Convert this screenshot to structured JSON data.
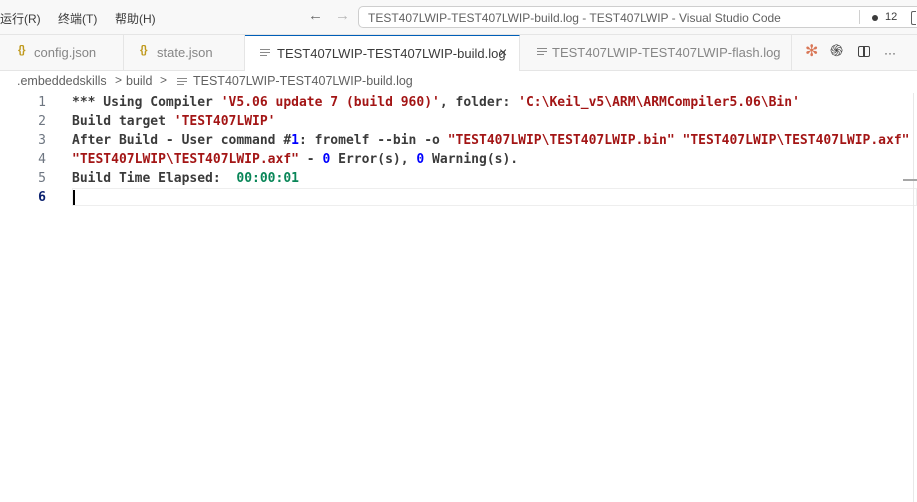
{
  "menu": {
    "run": "运行(R)",
    "terminal": "终端(T)",
    "help": "帮助(H)"
  },
  "navigation": {
    "back": "←",
    "forward": "→"
  },
  "command_center": {
    "title": "TEST407LWIP-TEST407LWIP-build.log - TEST407LWIP - Visual Studio Code",
    "problem_count": "12"
  },
  "tabs": [
    {
      "label": "config.json",
      "icon": "json-braces-icon",
      "active": false
    },
    {
      "label": "state.json",
      "icon": "json-braces-icon",
      "active": false
    },
    {
      "label": "TEST407LWIP-TEST407LWIP-build.log",
      "icon": "file-lines-icon",
      "active": true
    },
    {
      "label": "TEST407LWIP-TEST407LWIP-flash.log",
      "icon": "file-lines-icon",
      "active": false
    }
  ],
  "tab_close": "×",
  "tab_actions": {
    "claude": "✻",
    "chatgpt": "֍",
    "more": "···"
  },
  "breadcrumb": [
    ".embeddedskills",
    "build",
    "TEST407LWIP-TEST407LWIP-build.log"
  ],
  "breadcrumb_sep": ">",
  "editor": {
    "current_line": 6,
    "lines": [
      {
        "number": "1",
        "parts": [
          "*** Using Compiler ",
          "'V5.06 update 7 (build 960)'",
          ", folder: ",
          "'C:\\Keil_v5\\ARM\\ARMCompiler5.06\\Bin'"
        ]
      },
      {
        "number": "2",
        "parts": [
          "Build target ",
          "'TEST407LWIP'"
        ]
      },
      {
        "number": "3",
        "parts": [
          "After Build - User command #",
          "1",
          ": fromelf --bin -o ",
          "\"TEST407LWIP\\TEST407LWIP.bin\"",
          " ",
          "\"TEST407LWIP\\TEST407LWIP.axf\""
        ]
      },
      {
        "number": "4",
        "parts": [
          "\"TEST407LWIP\\TEST407LWIP.axf\"",
          " - ",
          "0",
          " Error(s), ",
          "0",
          " Warning(s)."
        ]
      },
      {
        "number": "5",
        "parts": [
          "Build Time Elapsed:  ",
          "00:00:01"
        ]
      },
      {
        "number": "6",
        "parts": []
      }
    ]
  },
  "colors": {
    "string": "#a31515",
    "number_green": "#098658",
    "number_blue": "#0000ff",
    "active_tab_accent": "#005fb8"
  }
}
